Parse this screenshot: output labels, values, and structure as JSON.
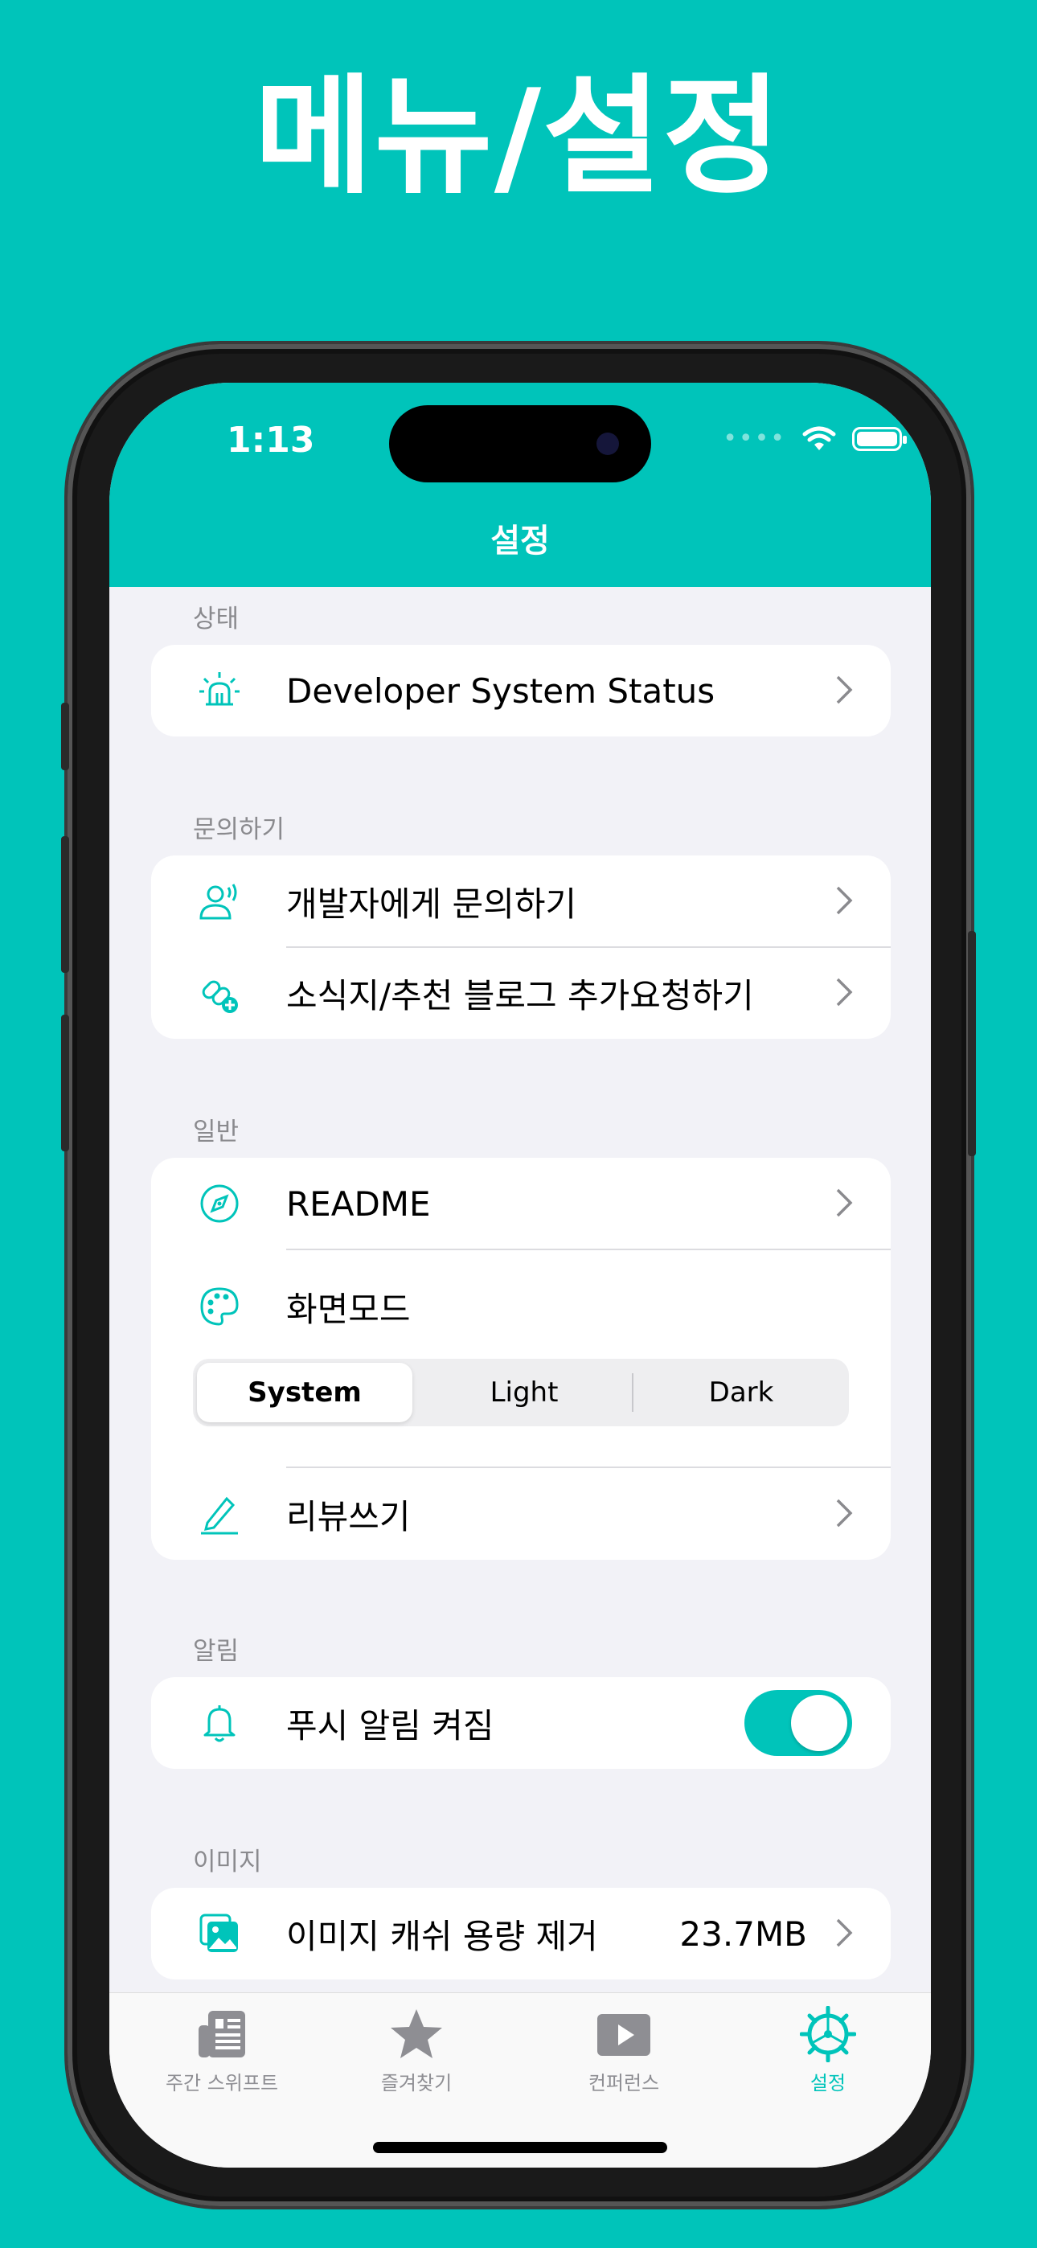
{
  "hero": {
    "title": "메뉴/설정"
  },
  "status_bar": {
    "time": "1:13"
  },
  "nav": {
    "title": "설정"
  },
  "sections": {
    "status": {
      "label": "상태",
      "items": [
        {
          "label": "Developer System Status",
          "icon": "beacon-icon"
        }
      ]
    },
    "contact": {
      "label": "문의하기",
      "items": [
        {
          "label": "개발자에게 문의하기",
          "icon": "person-speaking-icon"
        },
        {
          "label": "소식지/추천 블로그 추가요청하기",
          "icon": "link-add-icon"
        }
      ]
    },
    "general": {
      "label": "일반",
      "readme": "README",
      "display_mode": "화면모드",
      "segment": {
        "options": [
          "System",
          "Light",
          "Dark"
        ],
        "selected": "System"
      },
      "review": "리뷰쓰기"
    },
    "notifications": {
      "label": "알림",
      "push": "푸시 알림 켜짐",
      "push_on": true
    },
    "image": {
      "label": "이미지",
      "clear_cache": "이미지 캐쉬 용량 제거",
      "cache_size": "23.7MB"
    }
  },
  "tabbar": {
    "tabs": [
      {
        "label": "주간 스위프트",
        "icon": "newspaper-icon"
      },
      {
        "label": "즐겨찾기",
        "icon": "star-icon"
      },
      {
        "label": "컨퍼런스",
        "icon": "play-icon"
      },
      {
        "label": "설정",
        "icon": "gear-icon",
        "active": true
      }
    ]
  },
  "colors": {
    "accent": "#00C4BA",
    "background": "#F2F2F7"
  }
}
